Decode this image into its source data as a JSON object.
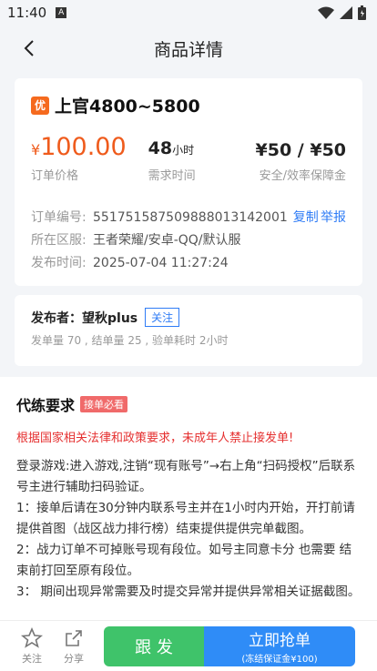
{
  "status": {
    "time": "11:40",
    "sim_glyph": "A"
  },
  "header": {
    "title": "商品详情"
  },
  "order": {
    "logo_char": "优",
    "title": "上官4800~5800",
    "price_symbol": "¥",
    "price_value": "100.00",
    "price_label": "订单价格",
    "duration_value": "48",
    "duration_unit": "小时",
    "duration_label": "需求时间",
    "deposit_value": "¥50 / ¥50",
    "deposit_label": "安全/效率保障金",
    "order_no_key": "订单编号:",
    "order_no_val": "551751587509888013142001",
    "copy_label": "复制",
    "report_label": "举报",
    "region_key": "所在区服:",
    "region_val": "王者荣耀/安卓-QQ/默认服",
    "time_key": "发布时间:",
    "time_val": "2025-07-04 11:27:24"
  },
  "publisher": {
    "name": "发布者：望秋plus",
    "follow_label": "关注",
    "stats": "发单量 70 , 结单量 25 , 验单耗时 2小时"
  },
  "requirements": {
    "title": "代练要求",
    "badge": "接单必看",
    "warning": "根据国家相关法律和政策要求，未成年人禁止接发单!",
    "lines": [
      "登录游戏:进入游戏,注销“现有账号”→右上角“扫码授权”后联系号主进行辅助扫码验证。",
      "1：接单后请在30分钟内联系号主并在1小时内开始，开打前请提供首图（战区战力排行榜）结束提供提供完单截图。",
      "2：战力订单不可掉账号现有段位。如号主同意卡分 也需要 结束前打回至原有段位。",
      "3：  期间出现异常需要及时提交异常并提供异常相关证据截图。"
    ]
  },
  "bottom": {
    "fav_label": "关注",
    "share_label": "分享",
    "follow_bid_label": "跟 发",
    "grab_label": "立即抢单",
    "grab_sub": "(冻结保证金¥100)"
  }
}
